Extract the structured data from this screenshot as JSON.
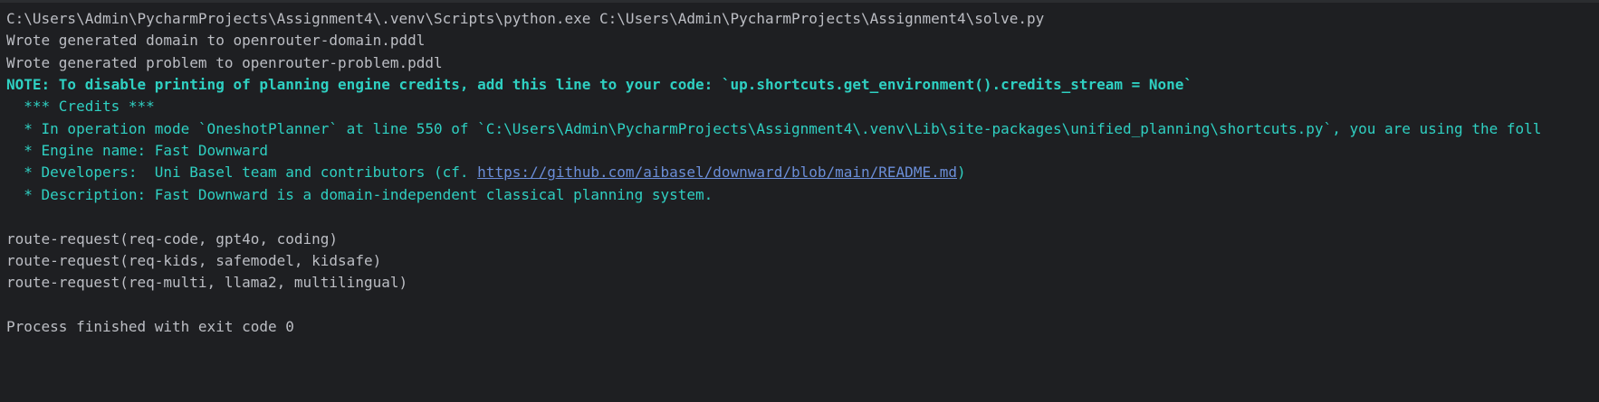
{
  "console": {
    "command": "C:\\Users\\Admin\\PycharmProjects\\Assignment4\\.venv\\Scripts\\python.exe C:\\Users\\Admin\\PycharmProjects\\Assignment4\\solve.py",
    "wrote_domain": "Wrote generated domain to openrouter-domain.pddl",
    "wrote_problem": "Wrote generated problem to openrouter-problem.pddl",
    "note": "NOTE: To disable printing of planning engine credits, add this line to your code: `up.shortcuts.get_environment().credits_stream = None`",
    "credits_header": "  *** Credits ***",
    "credits_mode": "  * In operation mode `OneshotPlanner` at line 550 of `C:\\Users\\Admin\\PycharmProjects\\Assignment4\\.venv\\Lib\\site-packages\\unified_planning\\shortcuts.py`, you are using the foll",
    "engine_name": "  * Engine name: Fast Downward",
    "developers_prefix": "  * Developers:  Uni Basel team and contributors (cf. ",
    "developers_link": "https://github.com/aibasel/downward/blob/main/README.md",
    "developers_suffix": ")",
    "description": "  * Description: Fast Downward is a domain-independent classical planning system.",
    "plan": [
      "route-request(req-code, gpt4o, coding)",
      "route-request(req-kids, safemodel, kidsafe)",
      "route-request(req-multi, llama2, multilingual)"
    ],
    "exit_message": "Process finished with exit code 0"
  },
  "colors": {
    "background": "#1e1f22",
    "default_text": "#bcbec4",
    "note_text": "#2fd0c2",
    "link": "#6b8ed8"
  }
}
